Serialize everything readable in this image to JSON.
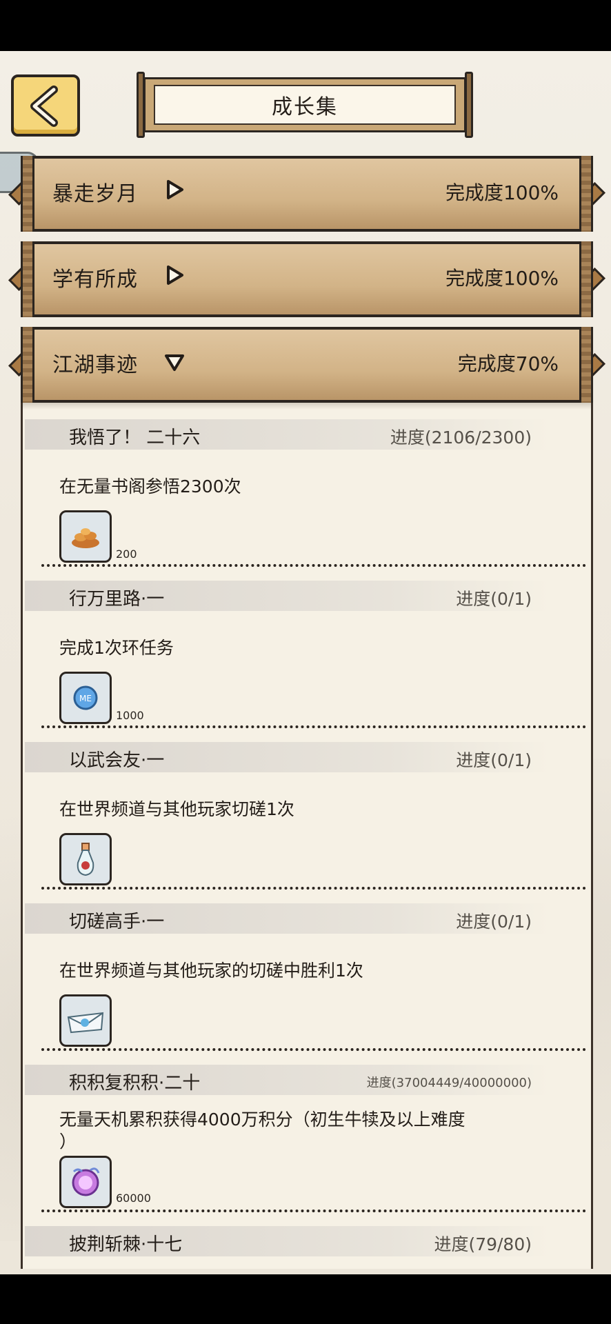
{
  "header": {
    "title": "成长集"
  },
  "categories": [
    {
      "name": "暴走岁月",
      "completion": "完成度100%",
      "state": "collapsed"
    },
    {
      "name": "学有所成",
      "completion": "完成度100%",
      "state": "collapsed"
    },
    {
      "name": "江湖事迹",
      "completion": "完成度70%",
      "state": "expanded"
    }
  ],
  "quests": [
    {
      "name": "我悟了！ 二十六",
      "progress": "进度(2106/2300)",
      "desc": "在无量书阁参悟2300次",
      "reward_icon": "gold-ingots-icon",
      "reward_qty": "200"
    },
    {
      "name": "行万里路·一",
      "progress": "进度(0/1)",
      "desc": "完成1次环任务",
      "reward_icon": "me-coin-icon",
      "reward_qty": "1000"
    },
    {
      "name": "以武会友·一",
      "progress": "进度(0/1)",
      "desc": "在世界频道与其他玩家切磋1次",
      "reward_icon": "potion-bottle-icon",
      "reward_qty": ""
    },
    {
      "name": "切磋高手·一",
      "progress": "进度(0/1)",
      "desc": "在世界频道与其他玩家的切磋中胜利1次",
      "reward_icon": "envelope-icon",
      "reward_qty": ""
    },
    {
      "name": "积积复积积·二十",
      "progress": "进度(37004449/40000000)",
      "desc": "无量天机累积获得4000万积分（初生牛犊及以上难度",
      "desc2": "）",
      "reward_icon": "purple-orb-icon",
      "reward_qty": "60000"
    },
    {
      "name": "披荆斩棘·十七",
      "progress": "进度(79/80)"
    }
  ]
}
